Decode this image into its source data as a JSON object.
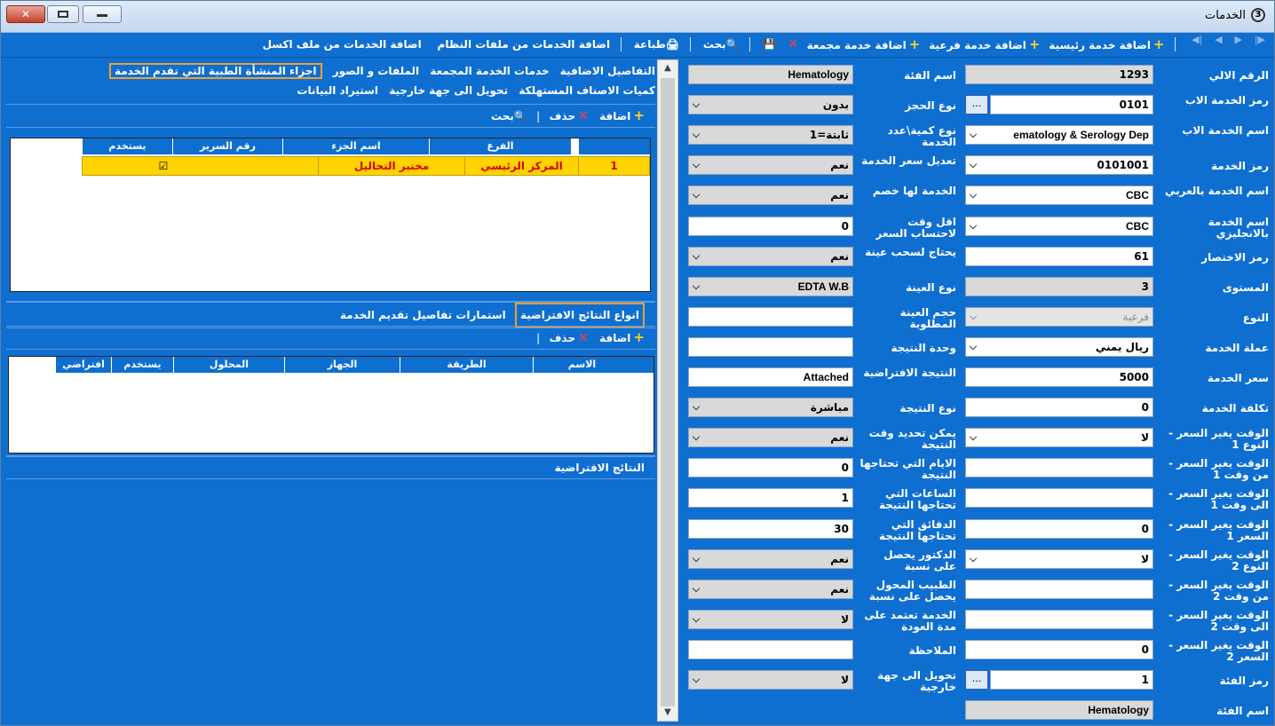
{
  "window": {
    "title": "الخدمات"
  },
  "toolbar": {
    "items": [
      "اضافة خدمة رئيسية",
      "اضافة خدمة فرعية",
      "اضافة خدمة مجمعة",
      "بحث",
      "طباعة",
      "اضافة الخدمات من ملفات النظام",
      "اضافة الخدمات من ملف اكسل"
    ]
  },
  "form": {
    "right": [
      {
        "label": "الرقم الالي",
        "value": "1293"
      },
      {
        "label": "رمز الخدمة الاب",
        "value": "0101"
      },
      {
        "label": "اسم الخدمة الاب",
        "value": "ematology & Serology Dep"
      },
      {
        "label": "رمز الخدمة",
        "value": "0101001"
      },
      {
        "label": "اسم الخدمة بالعربي",
        "value": "CBC"
      },
      {
        "label": "اسم الخدمة بالانجليزي",
        "value": "CBC"
      },
      {
        "label": "رمز الاختصار",
        "value": "61"
      },
      {
        "label": "المستوى",
        "value": "3"
      },
      {
        "label": "النوع",
        "value": "فرعية"
      },
      {
        "label": "عملة الخدمة",
        "value": "ريال يمني"
      },
      {
        "label": "سعر الخدمة",
        "value": "5000"
      },
      {
        "label": "تكلفة الخدمة",
        "value": "0"
      },
      {
        "label": "الوقت يغير السعر - النوع 1",
        "value": "لا"
      },
      {
        "label": "الوقت يغير السعر - من وقت 1",
        "value": ""
      },
      {
        "label": "الوقت يغير السعر - الى وقت 1",
        "value": ""
      },
      {
        "label": "الوقت يغير السعر - السعر 1",
        "value": "0"
      },
      {
        "label": "الوقت يغير السعر - النوع 2",
        "value": "لا"
      },
      {
        "label": "الوقت يغير السعر - من وقت 2",
        "value": ""
      },
      {
        "label": "الوقت يغير السعر - الى وقت 2",
        "value": ""
      },
      {
        "label": "الوقت يغير السعر - السعر 2",
        "value": "0"
      },
      {
        "label": "رمز الفئة",
        "value": "1"
      },
      {
        "label": "اسم الفئة",
        "value": "Hematology"
      }
    ],
    "mid": [
      {
        "label": "اسم الفئة",
        "value": "Hematology"
      },
      {
        "label": "نوع الحجز",
        "value": "بدون"
      },
      {
        "label": "نوع كمية\\عدد الخدمة",
        "value": "ثابتة=1"
      },
      {
        "label": "تعديل سعر الخدمة",
        "value": "نعم"
      },
      {
        "label": "الخدمة لها خصم",
        "value": "نعم"
      },
      {
        "label": "اقل وقت لاحتساب السعر",
        "value": "0"
      },
      {
        "label": "يحتاج لسحب عينة",
        "value": "نعم"
      },
      {
        "label": "نوع العينة",
        "value": "EDTA W.B"
      },
      {
        "label": "حجم العينة المطلوبة",
        "value": ""
      },
      {
        "label": "وحدة النتيجة",
        "value": ""
      },
      {
        "label": "النتيجة الافتراضية",
        "value": "Attached"
      },
      {
        "label": "نوع النتيجة",
        "value": "مباشرة"
      },
      {
        "label": "يمكن تحديد وقت النتيجة",
        "value": "نعم"
      },
      {
        "label": "الايام التي تحتاجها النتيجة",
        "value": "0"
      },
      {
        "label": "الساعات التي تحتاجها النتيجة",
        "value": "1"
      },
      {
        "label": "الدقائق التي تحتاجها النتيجة",
        "value": "30"
      },
      {
        "label": "الدكتور يحصل على نسبة",
        "value": "نعم"
      },
      {
        "label": "الطبيب المحول يحصل على نسبة",
        "value": "نعم"
      },
      {
        "label": "الخدمة تعتمد على مدة العودة",
        "value": "لا"
      },
      {
        "label": "الملاحظة",
        "value": ""
      },
      {
        "label": "تحويل الى جهة خارجية",
        "value": "لا"
      }
    ]
  },
  "left": {
    "tabs_row1": [
      "التفاصيل الاضافية",
      "خدمات الخدمة المجمعة",
      "الملفات و الصور",
      "اجزاء المنشأة الطبية التي تقدم الخدمة"
    ],
    "tabs_row2": [
      "كميات الاصناف المستهلكة",
      "تحويل الى جهة خارجية",
      "استيراد البيانات"
    ],
    "actions1": {
      "add": "اضافة",
      "delete": "حذف",
      "search": "بحث"
    },
    "grid1": {
      "headers": [
        "الفرع",
        "اسم الجزء",
        "رقم السرير",
        "يستخدم"
      ],
      "rows": [
        {
          "no": "1",
          "branch": "المركز الرئيسي",
          "part": "مختبر التحاليل",
          "bed": "",
          "used": "☑"
        }
      ]
    },
    "tabs2": [
      "انواع النتائج الافتراضية",
      "استمارات تفاصيل تقديم الخدمة"
    ],
    "actions2": {
      "add": "اضافة",
      "delete": "حذف"
    },
    "grid2": {
      "headers": [
        "الاسم",
        "الطريقة",
        "الجهاز",
        "المحلول",
        "يستخدم",
        "افتراضي"
      ]
    },
    "section3": "النتائج الافتراضية"
  }
}
